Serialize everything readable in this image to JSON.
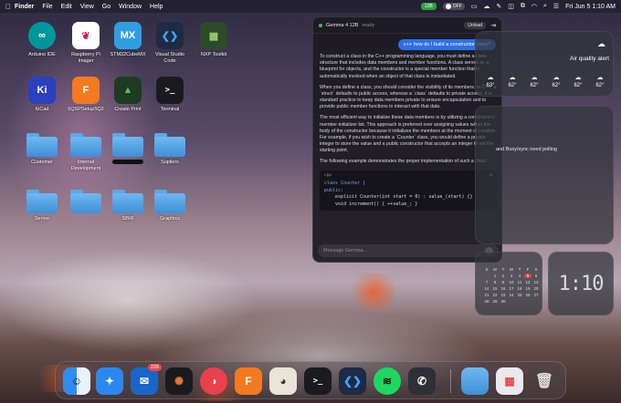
{
  "menubar": {
    "app": "Finder",
    "items": [
      "File",
      "Edit",
      "View",
      "Go",
      "Window",
      "Help"
    ],
    "badge": "12B",
    "toggle_label": "OFF",
    "datetime": "Fri Jun 5  1:10 AM"
  },
  "desktop": {
    "icons": [
      {
        "label": "Arduino IDE"
      },
      {
        "label": "Raspberry Pi Imager"
      },
      {
        "label": "STM32CubeMX",
        "glyph": "MX"
      },
      {
        "label": "Visual Studio Code"
      },
      {
        "label": "NXP Toolkit"
      },
      {
        "label": "KiCad",
        "glyph": "Ki"
      },
      {
        "label": "6QSPSetup5Q2",
        "glyph": "F"
      },
      {
        "label": "Create Print"
      },
      {
        "label": "Terminal",
        "glyph": ">_"
      }
    ],
    "folders": [
      {
        "label": "Customer"
      },
      {
        "label": "Internal Development"
      },
      {
        "label": ""
      },
      {
        "label": "Supliers"
      },
      {
        "label": "Server"
      },
      {
        "label": ""
      },
      {
        "label": "SBIR"
      },
      {
        "label": "Graphics"
      }
    ]
  },
  "chat": {
    "model": "Gemma 4 12B",
    "status": "ready",
    "unload": "Unload",
    "user_message": "c++ how do I build a constructor class?",
    "para1": "To construct a class in the C++ programming language, you must define a class structure that includes data members and member functions. A class serves as a blueprint for objects, and the constructor is a special member function that is automatically invoked when an object of that class is instantiated.",
    "para2": "When you define a class, you should consider the visibility of its members. In C++, a `struct` defaults to public access, whereas a `class` defaults to private access. It is standard practice to keep data members private to ensure encapsulation and to provide public member functions to interact with that data.",
    "para3": "The most efficient way to initialize these data members is by utilizing a constructor's member-initializer list. This approach is preferred over assigning values within the body of the constructor because it initializes the members at the moment of creation. For example, if you wish to create a `Counter` class, you would define a private integer to store the value and a public constructor that accepts an integer to set the starting point.",
    "para4": "The following example demonstrates the proper implementation of such a class:",
    "code_lang": "cpp",
    "code_line1": "class Counter {",
    "code_line2": "public:",
    "code_line3": "    explicit Counter(int start = 0) : value_(start) {}",
    "code_line4": "    void increment() { ++value_; }",
    "placeholder": "Message Gemma..."
  },
  "widgets": {
    "weather": {
      "alert": "Air quality alert",
      "hours": [
        {
          "time": "1AM",
          "temp": "63°"
        },
        {
          "time": "2AM",
          "temp": "62°"
        },
        {
          "time": "3AM",
          "temp": "62°"
        },
        {
          "time": "4AM",
          "temp": "62°"
        },
        {
          "time": "5AM",
          "temp": "62°"
        },
        {
          "time": "6AM",
          "temp": "62°"
        }
      ]
    },
    "reminder_text": "and Busy/sync need polling",
    "month": {
      "days": [
        "S",
        "M",
        "T",
        "W",
        "T",
        "F",
        "S"
      ],
      "dates": [
        "",
        "1",
        "2",
        "3",
        "4",
        "5",
        "6",
        "7",
        "8",
        "9",
        "10",
        "11",
        "12",
        "13",
        "14",
        "15",
        "16",
        "17",
        "18",
        "19",
        "20",
        "21",
        "22",
        "23",
        "24",
        "25",
        "26",
        "27",
        "28",
        "29",
        "30",
        "",
        "",
        "",
        ""
      ],
      "today": "5"
    },
    "clock": "1:10"
  },
  "dock": {
    "mail_badge": "229",
    "items": [
      "Finder",
      "Safari",
      "Outlook",
      "Perplexity",
      "Pixelmator",
      "Fusion",
      "Capture",
      "Terminal",
      "VS Code",
      "Spotify",
      "Phone",
      "Folder",
      "Launchpad",
      "Trash"
    ]
  }
}
